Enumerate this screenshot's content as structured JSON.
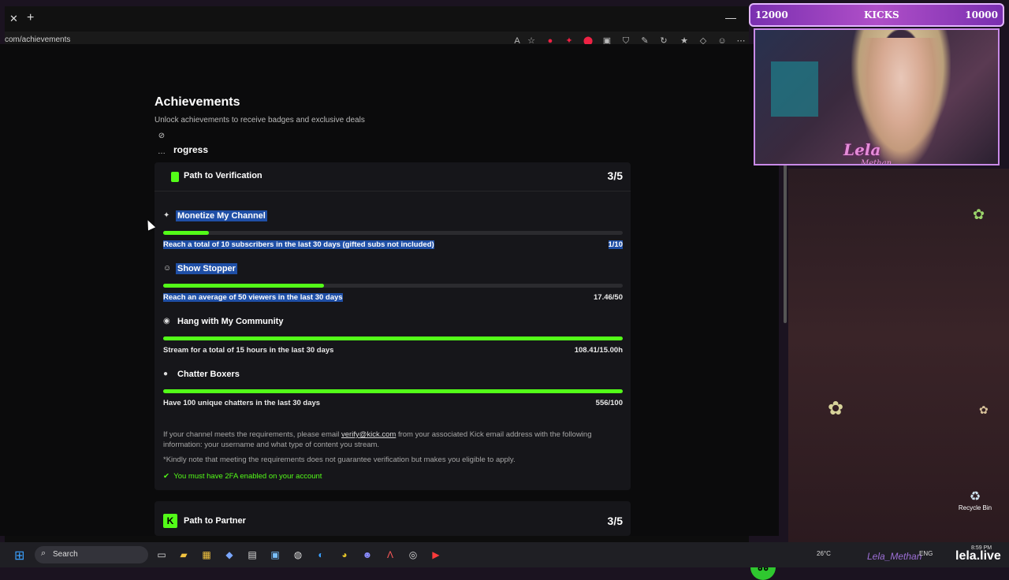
{
  "browser": {
    "url": "com/achievements",
    "close_glyph": "✕",
    "newtab_glyph": "+",
    "minimize_glyph": "—"
  },
  "page": {
    "title": "Achievements",
    "subtitle": "Unlock achievements to receive badges and exclusive deals",
    "progress_heading": "rogress"
  },
  "verification": {
    "title": "Path to Verification",
    "score": "3/5",
    "items": [
      {
        "title": "Monetize My Channel",
        "requirement": "Reach a total of 10 subscribers in the last 30 days (gifted subs not included)",
        "value": "1/10",
        "progress": 0.1
      },
      {
        "title": "Show Stopper",
        "requirement": "Reach an average of 50 viewers in the last 30 days",
        "value": "17.46/50",
        "progress": 0.35
      },
      {
        "title": "Hang with My Community",
        "requirement": "Stream for a total of 15 hours in the last 30 days",
        "value": "108.41/15.00h",
        "progress": 1.0
      },
      {
        "title": "Chatter Boxers",
        "requirement": "Have 100 unique chatters in the last 30 days",
        "value": "556/100",
        "progress": 1.0
      }
    ],
    "info_pre": "If your channel meets the requirements, please email ",
    "info_email": "verify@kick.com",
    "info_post": " from your associated Kick email address with the following information: your username and what type of content you stream.",
    "note": "*Kindly note that meeting the requirements does not guarantee verification but makes you eligible to apply.",
    "twofa": "You must have 2FA enabled on your account"
  },
  "partner": {
    "title": "Path to Partner",
    "score": "3/5",
    "logo_letter": "K"
  },
  "overlay": {
    "kicks_left": "12000",
    "kicks_label": "KICKS",
    "kicks_right": "10000",
    "name": "Lela",
    "name_sub": "Methan",
    "recycle_label": "Recycle Bin"
  },
  "taskbar": {
    "search_placeholder": "Search",
    "weather": "26°C",
    "lang": "ENG",
    "time": "8:59 PM",
    "date": "",
    "brand": "lela.live",
    "handle": "Lela_Methan"
  },
  "colors": {
    "accent": "#53fc18",
    "selection": "#1f4fa6",
    "overlay_purple": "#b04fc8"
  }
}
